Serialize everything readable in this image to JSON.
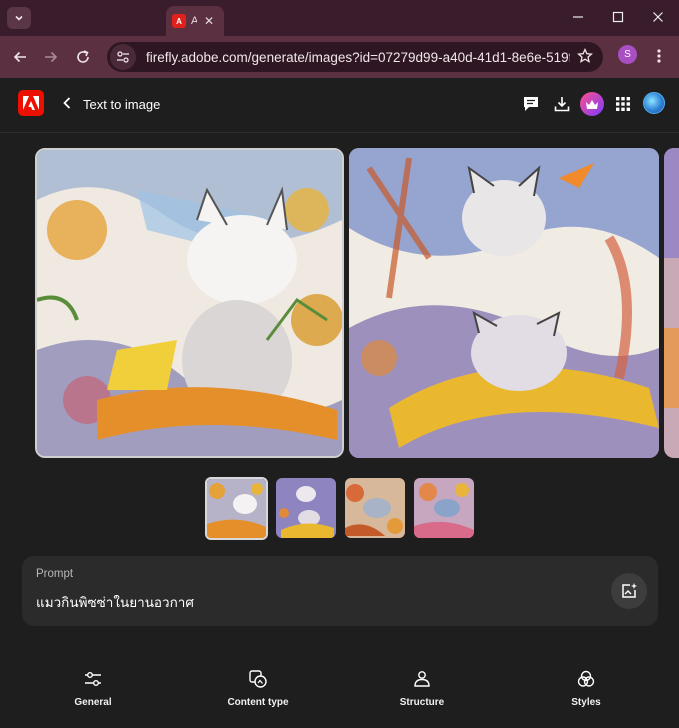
{
  "browser": {
    "tab_title": "A",
    "url": "firefly.adobe.com/generate/images?id=07279d99-a40d-41d1-8e6e-519f89ca...",
    "profile_initial": "S"
  },
  "app": {
    "page_title": "Text to image",
    "logo_icon": "adobe-logo-icon",
    "accent": "#eb1000"
  },
  "gallery": {
    "selected_index": 0,
    "thumbnail_count": 4
  },
  "prompt": {
    "label": "Prompt",
    "text": "แมวกินพิซซ่าในยานอวกาศ"
  },
  "toolbar": {
    "items": [
      {
        "label": "General",
        "icon": "sliders-icon"
      },
      {
        "label": "Content type",
        "icon": "content-type-icon"
      },
      {
        "label": "Structure",
        "icon": "structure-icon"
      },
      {
        "label": "Styles",
        "icon": "styles-icon"
      }
    ]
  }
}
